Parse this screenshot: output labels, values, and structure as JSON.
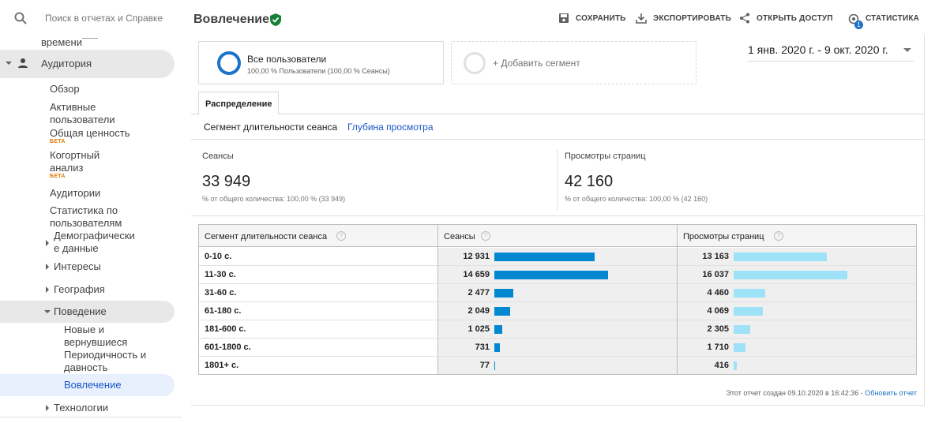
{
  "search": {
    "placeholder": "Поиск в отчетах и Справке"
  },
  "sidebar": {
    "cut_item": "времени",
    "audience": "Аудитория",
    "overview": "Обзор",
    "active_users": [
      "Активные",
      "пользователи"
    ],
    "ltv": "Общая ценность",
    "ltv_badge": "БЕТА",
    "cohort": [
      "Когортный",
      "анализ"
    ],
    "cohort_badge": "БЕТА",
    "audiences": "Аудитории",
    "user_explorer": [
      "Статистика по",
      "пользователям"
    ],
    "demographics": [
      "Демографически",
      "е данные"
    ],
    "interests": "Интересы",
    "geo": "География",
    "behavior": "Поведение",
    "new_vs_returning": [
      "Новые и",
      "вернувшиеся"
    ],
    "frequency": [
      "Периодичность и",
      "давность"
    ],
    "engagement": "Вовлечение",
    "technology": "Технологии"
  },
  "header": {
    "title": "Вовлечение",
    "save": "СОХРАНИТЬ",
    "export": "ЭКСПОРТИРОВАТЬ",
    "share": "ОТКРЫТЬ ДОСТУП",
    "insights": "СТАТИСТИКА",
    "insights_count": "1"
  },
  "segments": {
    "all_users_title": "Все пользователи",
    "all_users_sub": "100,00 % Пользователи (100,00 % Сеансы)",
    "add_segment": "+ Добавить сегмент"
  },
  "date_range": "1 янв. 2020 г. - 9 окт. 2020 г.",
  "tab": "Распределение",
  "subtabs": {
    "active": "Сегмент длительности сеанса",
    "link": "Глубина просмотра"
  },
  "scorecards": [
    {
      "label": "Сеансы",
      "value": "33 949",
      "sub": "% от общего количества: 100,00 % (33 949)"
    },
    {
      "label": "Просмотры страниц",
      "value": "42 160",
      "sub": "% от общего количества: 100,00 % (42 160)"
    }
  ],
  "table": {
    "headers": [
      "Сегмент длительности сеанса",
      "Сеансы",
      "Просмотры страниц"
    ],
    "help": "?",
    "rows": [
      {
        "label": "0-10 с.",
        "sessions": "12 931",
        "pageviews": "13 163"
      },
      {
        "label": "11-30 с.",
        "sessions": "14 659",
        "pageviews": "16 037"
      },
      {
        "label": "31-60 с.",
        "sessions": "2 477",
        "pageviews": "4 460"
      },
      {
        "label": "61-180 с.",
        "sessions": "2 049",
        "pageviews": "4 069"
      },
      {
        "label": "181-600 с.",
        "sessions": "1 025",
        "pageviews": "2 305"
      },
      {
        "label": "601-1800 с.",
        "sessions": "731",
        "pageviews": "1 710"
      },
      {
        "label": "1801+ с.",
        "sessions": "77",
        "pageviews": "416"
      }
    ],
    "sessions_values": [
      12931,
      14659,
      2477,
      2049,
      1025,
      731,
      77
    ],
    "pageviews_values": [
      13163,
      16037,
      4460,
      4069,
      2305,
      1710,
      416
    ],
    "sessions_color": "#0288d1",
    "pageviews_color": "#9ee2f7"
  },
  "footer": {
    "text": "Этот отчет создан 09.10.2020 в 16:42:36 - ",
    "link": "Обновить отчет"
  }
}
